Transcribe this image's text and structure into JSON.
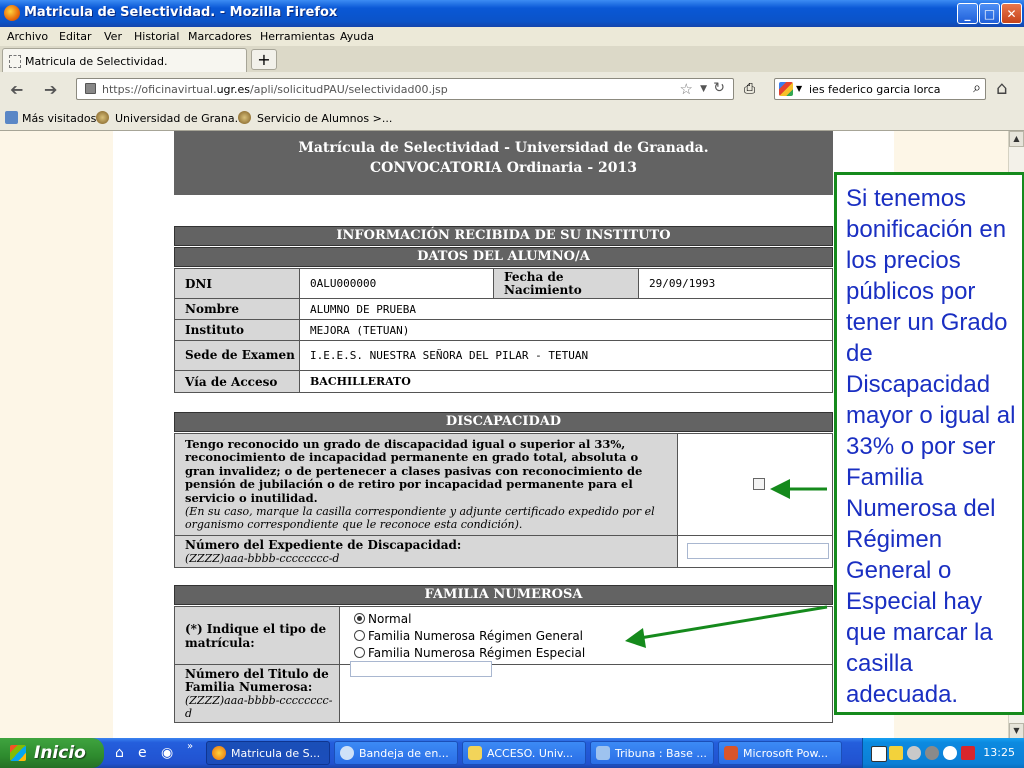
{
  "window": {
    "title": "Matricula de Selectividad. - Mozilla Firefox",
    "min_label": "_",
    "max_label": "□",
    "close_label": "✕"
  },
  "menu": [
    "Archivo",
    "Editar",
    "Ver",
    "Historial",
    "Marcadores",
    "Herramientas",
    "Ayuda"
  ],
  "tab": {
    "label": "Matricula de Selectividad.",
    "newtab_label": "+"
  },
  "nav": {
    "back_icon": "arrow-left-icon",
    "forward_icon": "arrow-right-icon",
    "url_prefix": "https://oficinavirtual.",
    "url_domain": "ugr.es",
    "url_path": "/apli/solicitudPAU/selectividad00.jsp",
    "search_value": "ies federico garcia lorca"
  },
  "bookmarks": [
    "Más visitados",
    "Universidad de Grana...",
    "Servicio de Alumnos >..."
  ],
  "page": {
    "header_line1": "Matrícula de Selectividad - Universidad de Granada.",
    "header_line2": "CONVOCATORIA Ordinaria - 2013",
    "info_title": "INFORMACIÓN RECIBIDA DE SU INSTITUTO",
    "alumno_title": "DATOS DEL ALUMNO/A",
    "dni_label": "DNI",
    "dni_value": "0ALU000000",
    "fecha_label": "Fecha de Nacimiento",
    "fecha_value": "29/09/1993",
    "nombre_label": "Nombre",
    "nombre_value": "ALUMNO DE PRUEBA",
    "instituto_label": "Instituto",
    "instituto_value": "MEJORA (TETUAN)",
    "sede_label": "Sede de Examen",
    "sede_value": "I.E.E.S. NUESTRA SEÑORA DEL PILAR - TETUAN",
    "via_label": "Vía de Acceso",
    "via_value": "BACHILLERATO",
    "disc_title": "DISCAPACIDAD",
    "disc_text": "Tengo reconocido un grado de discapacidad igual o superior al 33%, reconocimiento de incapacidad permanente en grado total, absoluta o gran invalidez; o de pertenecer a clases pasivas con reconocimiento de pensión de jubilación o de retiro por incapacidad permanente para el servicio o inutilidad.",
    "disc_note": "(En su caso, marque la casilla correspondiente y adjunte certificado expedido por el organismo correspondiente que le reconoce esta condición).",
    "exp_label": "Número del Expediente de Discapacidad:",
    "exp_format": "(ZZZZ)aaa-bbbb-cccccccc-d",
    "fam_title": "FAMILIA NUMEROSA",
    "tipo_label": "(*) Indique el tipo de matrícula:",
    "radio_options": [
      "Normal",
      "Familia Numerosa Régimen General",
      "Familia Numerosa Régimen Especial"
    ],
    "radio_selected": "Normal",
    "titulo_label": "Número del Titulo de Familia Numerosa:",
    "titulo_format": "(ZZZZ)aaa-bbbb-cccccccc-d"
  },
  "annotation": "Si tenemos bonificación en los precios públicos por tener un Grado de Discapacidad mayor o igual al 33% o por ser Familia Numerosa del Régimen General o Especial hay que marcar la casilla adecuada.",
  "colors": {
    "annotation_border": "#158a1c",
    "annotation_text": "#1a2fc2",
    "section_header": "#636363",
    "arrow": "#158a1c"
  },
  "taskbar": {
    "start_label": "Inicio",
    "items": [
      "Matricula de S...",
      "Bandeja de en...",
      "ACCESO.  Univ...",
      "Tribuna : Base ...",
      "Microsoft Pow..."
    ],
    "clock": "13:25"
  }
}
